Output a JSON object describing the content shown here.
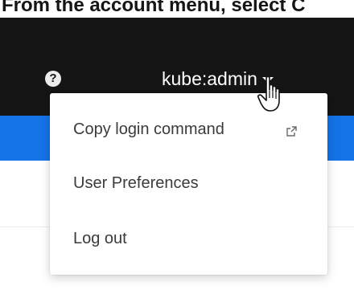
{
  "caption": "From the account menu, select C",
  "masthead": {
    "help_icon": "question-circle-icon",
    "user_name": "kube:admin",
    "caret_icon": "caret-down-icon",
    "background_color": "#151515"
  },
  "nav_bar_color": "#1473e6",
  "account_menu": {
    "items": [
      {
        "label": "Copy login command",
        "icon": "external-link-icon"
      },
      {
        "label": "User Preferences"
      },
      {
        "label": "Log out"
      }
    ]
  },
  "cursor": "hand-pointer-icon"
}
